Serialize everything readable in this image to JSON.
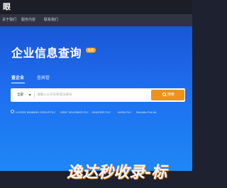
{
  "header": {
    "brand": "眼"
  },
  "nav": {
    "items": [
      "关于我们",
      "服务内容",
      "联系我们"
    ]
  },
  "hero": {
    "title": "企业信息查询",
    "badge": "免费"
  },
  "tabs": [
    {
      "label": "查企业",
      "active": true
    },
    {
      "label": "查高管",
      "active": false
    }
  ],
  "search": {
    "scope": "全部",
    "placeholder": "请输入公司名称或注册号",
    "button": "搜索"
  },
  "suggestions": [
    "LLOYDS BANKING GROUP PLC",
    "HSBC HOLDINGS PLC",
    "UNILEVER PLC",
    "AVIVA PLC",
    "Deloitte Pvt.ltd"
  ],
  "watermark": {
    "text": "逸达秒收录-标"
  },
  "colors": {
    "hero_start": "#1a56d6",
    "hero_end": "#1f87f6",
    "accent": "#f0921a",
    "badge": "#f5a623"
  }
}
